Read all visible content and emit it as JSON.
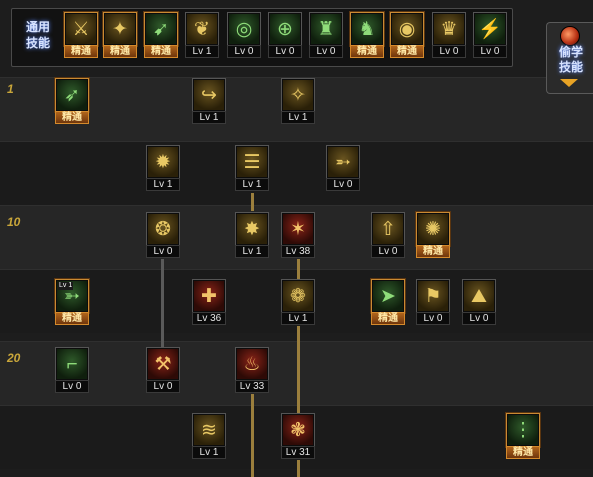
{
  "top_bar": {
    "label_line1": "通用",
    "label_line2": "技能",
    "skills": [
      {
        "icon": "skill-icon-1",
        "glyph": "⚔",
        "level": "精通"
      },
      {
        "icon": "skill-icon-2",
        "glyph": "✦",
        "level": "精通"
      },
      {
        "icon": "skill-icon-3",
        "glyph": "➹",
        "level": "精通"
      },
      {
        "icon": "skill-icon-4",
        "glyph": "❦",
        "level": "Lv 1"
      },
      {
        "icon": "skill-icon-5",
        "glyph": "◎",
        "level": "Lv 0"
      },
      {
        "icon": "skill-icon-6",
        "glyph": "⊕",
        "level": "Lv 0"
      },
      {
        "icon": "skill-icon-7",
        "glyph": "♜",
        "level": "Lv 0"
      },
      {
        "icon": "skill-icon-8",
        "glyph": "♞",
        "level": "精通"
      },
      {
        "icon": "skill-icon-9",
        "glyph": "◉",
        "level": "精通"
      },
      {
        "icon": "skill-icon-10",
        "glyph": "♛",
        "level": "Lv 0"
      },
      {
        "icon": "skill-icon-11",
        "glyph": "⚡",
        "level": "Lv 0"
      }
    ]
  },
  "steal_panel": {
    "label_line1": "偷学",
    "label_line2": "技能"
  },
  "level_labels": [
    "1",
    "10",
    "20"
  ],
  "tree_skills": [
    {
      "name": "skill-r1-a",
      "glyph": "➶",
      "level": "精通"
    },
    {
      "name": "skill-r1-b",
      "glyph": "↪",
      "level": "Lv 1"
    },
    {
      "name": "skill-r1-c",
      "glyph": "✧",
      "level": "Lv 1"
    },
    {
      "name": "skill-r2-a",
      "glyph": "✹",
      "level": "Lv 1"
    },
    {
      "name": "skill-r2-b",
      "glyph": "☰",
      "level": "Lv 1"
    },
    {
      "name": "skill-r2-c",
      "glyph": "➵",
      "level": "Lv 0"
    },
    {
      "name": "skill-r3-a",
      "glyph": "❂",
      "level": "Lv 0"
    },
    {
      "name": "skill-r3-b",
      "glyph": "✸",
      "level": "Lv 1"
    },
    {
      "name": "skill-r3-c",
      "glyph": "✶",
      "level": "Lv 38"
    },
    {
      "name": "skill-r3-d",
      "glyph": "⇧",
      "level": "Lv 0"
    },
    {
      "name": "skill-r3-e",
      "glyph": "✺",
      "level": "精通"
    },
    {
      "name": "skill-r4-a",
      "glyph": "➳",
      "level": "精通",
      "badge": "Lv 1"
    },
    {
      "name": "skill-r4-b",
      "glyph": "✚",
      "level": "Lv 36"
    },
    {
      "name": "skill-r4-c",
      "glyph": "❁",
      "level": "Lv 1"
    },
    {
      "name": "skill-r4-d",
      "glyph": "➤",
      "level": "精通"
    },
    {
      "name": "skill-r4-e",
      "glyph": "⚑",
      "level": "Lv 0"
    },
    {
      "name": "skill-r4-f",
      "glyph": "⛰",
      "level": "Lv 0"
    },
    {
      "name": "skill-r5-a",
      "glyph": "⌐",
      "level": "Lv 0"
    },
    {
      "name": "skill-r5-b",
      "glyph": "⚒",
      "level": "Lv 0"
    },
    {
      "name": "skill-r5-c",
      "glyph": "♨",
      "level": "Lv 33"
    },
    {
      "name": "skill-r6-a",
      "glyph": "≋",
      "level": "Lv 1"
    },
    {
      "name": "skill-r6-b",
      "glyph": "❃",
      "level": "Lv 31"
    },
    {
      "name": "skill-r6-c",
      "glyph": "⋮",
      "level": "精通"
    }
  ]
}
